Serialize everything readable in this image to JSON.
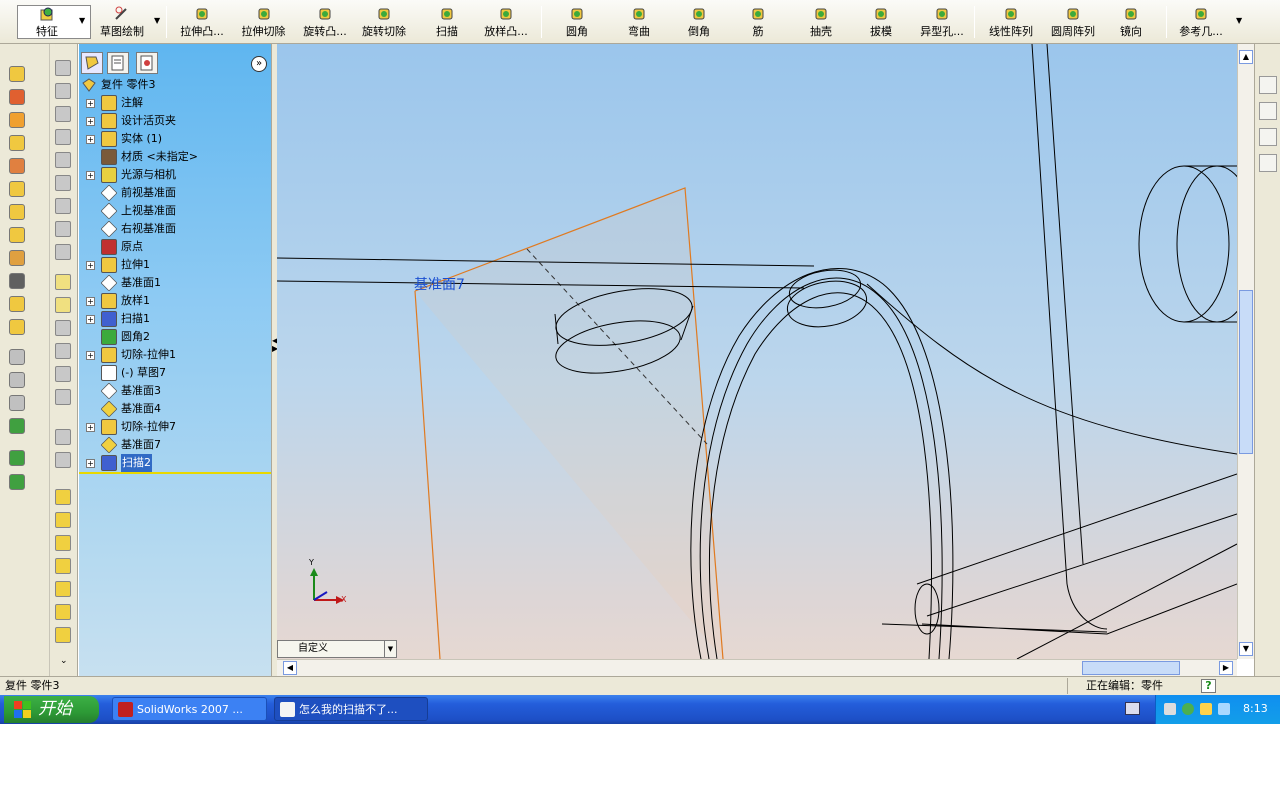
{
  "toolbar": {
    "mode_tabs": [
      {
        "label": "特征",
        "icon": "features-icon"
      },
      {
        "label": "草图绘制",
        "icon": "sketch-icon"
      }
    ],
    "buttons": [
      {
        "label": "拉伸凸...",
        "icon": "extrude-boss-icon"
      },
      {
        "label": "拉伸切除",
        "icon": "extrude-cut-icon"
      },
      {
        "label": "旋转凸...",
        "icon": "revolve-boss-icon"
      },
      {
        "label": "旋转切除",
        "icon": "revolve-cut-icon"
      },
      {
        "label": "扫描",
        "icon": "sweep-icon"
      },
      {
        "label": "放样凸...",
        "icon": "loft-icon"
      },
      {
        "label": "圆角",
        "icon": "fillet-icon"
      },
      {
        "label": "弯曲",
        "icon": "flex-icon"
      },
      {
        "label": "倒角",
        "icon": "chamfer-icon"
      },
      {
        "label": "筋",
        "icon": "rib-icon"
      },
      {
        "label": "抽壳",
        "icon": "shell-icon"
      },
      {
        "label": "拔模",
        "icon": "draft-icon"
      },
      {
        "label": "异型孔...",
        "icon": "hole-wizard-icon"
      },
      {
        "label": "线性阵列",
        "icon": "linear-pattern-icon"
      },
      {
        "label": "圆周阵列",
        "icon": "circular-pattern-icon"
      },
      {
        "label": "镜向",
        "icon": "mirror-icon"
      },
      {
        "label": "参考几...",
        "icon": "reference-geometry-icon"
      }
    ]
  },
  "tree": {
    "root": "复件 零件3",
    "items": [
      {
        "label": "注解",
        "expand": true,
        "icon": "annotations-icon"
      },
      {
        "label": "设计活页夹",
        "expand": true,
        "icon": "design-binder-icon"
      },
      {
        "label": "实体 (1)",
        "expand": true,
        "icon": "solid-bodies-icon"
      },
      {
        "label": "材质 <未指定>",
        "expand": false,
        "icon": "material-icon"
      },
      {
        "label": "光源与相机",
        "expand": true,
        "icon": "lights-cameras-icon"
      },
      {
        "label": "前视基准面",
        "expand": false,
        "icon": "plane-icon"
      },
      {
        "label": "上视基准面",
        "expand": false,
        "icon": "plane-icon"
      },
      {
        "label": "右视基准面",
        "expand": false,
        "icon": "plane-icon"
      },
      {
        "label": "原点",
        "expand": false,
        "icon": "origin-icon"
      },
      {
        "label": "拉伸1",
        "expand": true,
        "icon": "extrude-boss-icon"
      },
      {
        "label": "基准面1",
        "expand": false,
        "icon": "plane-icon"
      },
      {
        "label": "放样1",
        "expand": true,
        "icon": "loft-icon"
      },
      {
        "label": "扫描1",
        "expand": true,
        "icon": "sweep-icon"
      },
      {
        "label": "圆角2",
        "expand": false,
        "icon": "fillet-icon"
      },
      {
        "label": "切除-拉伸1",
        "expand": true,
        "icon": "extrude-cut-icon"
      },
      {
        "label": "(-) 草图7",
        "expand": false,
        "icon": "sketch-icon"
      },
      {
        "label": "基准面3",
        "expand": false,
        "icon": "plane-icon"
      },
      {
        "label": "基准面4",
        "expand": false,
        "icon": "plane-yellow-icon"
      },
      {
        "label": "切除-拉伸7",
        "expand": true,
        "icon": "extrude-cut-icon"
      },
      {
        "label": "基准面7",
        "expand": false,
        "icon": "plane-yellow-icon"
      },
      {
        "label": "扫描2",
        "expand": true,
        "icon": "sweep-icon",
        "selected": true
      }
    ]
  },
  "viewport": {
    "plane_label": "基准面7",
    "triad_x": "X",
    "triad_y": "Y",
    "view_combo": "自定义"
  },
  "status": {
    "left": "复件 零件3",
    "right": "正在编辑：零件",
    "help": "?"
  },
  "taskbar": {
    "start": "开始",
    "items": [
      {
        "label": "SolidWorks 2007 ...",
        "icon": "solidworks-icon"
      },
      {
        "label": "怎么我的扫描不了...",
        "icon": "ie-icon"
      }
    ],
    "clock": "8:13"
  },
  "colors": {
    "viewport_top": "#9bc6ec",
    "viewport_bottom": "#e6d8d2",
    "tree_bg": "#8dcaf3",
    "selection": "#316ac5",
    "plane_edge": "#e07a20",
    "plane_label": "#1a4fd0",
    "taskbar": "#245edb",
    "start": "#2d9a36"
  }
}
